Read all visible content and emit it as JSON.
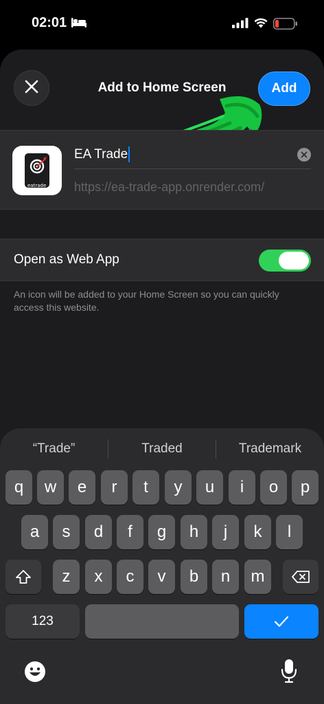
{
  "status_bar": {
    "time": "02:01",
    "icons": [
      "bed-icon",
      "cellular-signal-icon",
      "wifi-icon",
      "battery-low-icon"
    ]
  },
  "nav": {
    "close_icon": "close-icon",
    "title": "Add to Home Screen",
    "add_label": "Add"
  },
  "app_info": {
    "icon_caption": "eatrade",
    "name": "EA Trade",
    "url": "https://ea-trade-app.onrender.com/"
  },
  "web_app": {
    "label": "Open as Web App",
    "enabled": true,
    "description": "An icon will be added to your Home Screen so you can quickly access this website."
  },
  "keyboard": {
    "suggestions": [
      "“Trade”",
      "Traded",
      "Trademark"
    ],
    "row1": [
      "q",
      "w",
      "e",
      "r",
      "t",
      "y",
      "u",
      "i",
      "o",
      "p"
    ],
    "row2": [
      "a",
      "s",
      "d",
      "f",
      "g",
      "h",
      "j",
      "k",
      "l"
    ],
    "row3": [
      "z",
      "x",
      "c",
      "v",
      "b",
      "n",
      "m"
    ],
    "numbers_label": "123",
    "done_icon": "checkmark-icon",
    "emoji_icon": "emoji-icon",
    "mic_icon": "microphone-icon",
    "colors": {
      "accent": "#0a84ff",
      "toggle_on": "#30d158"
    }
  }
}
